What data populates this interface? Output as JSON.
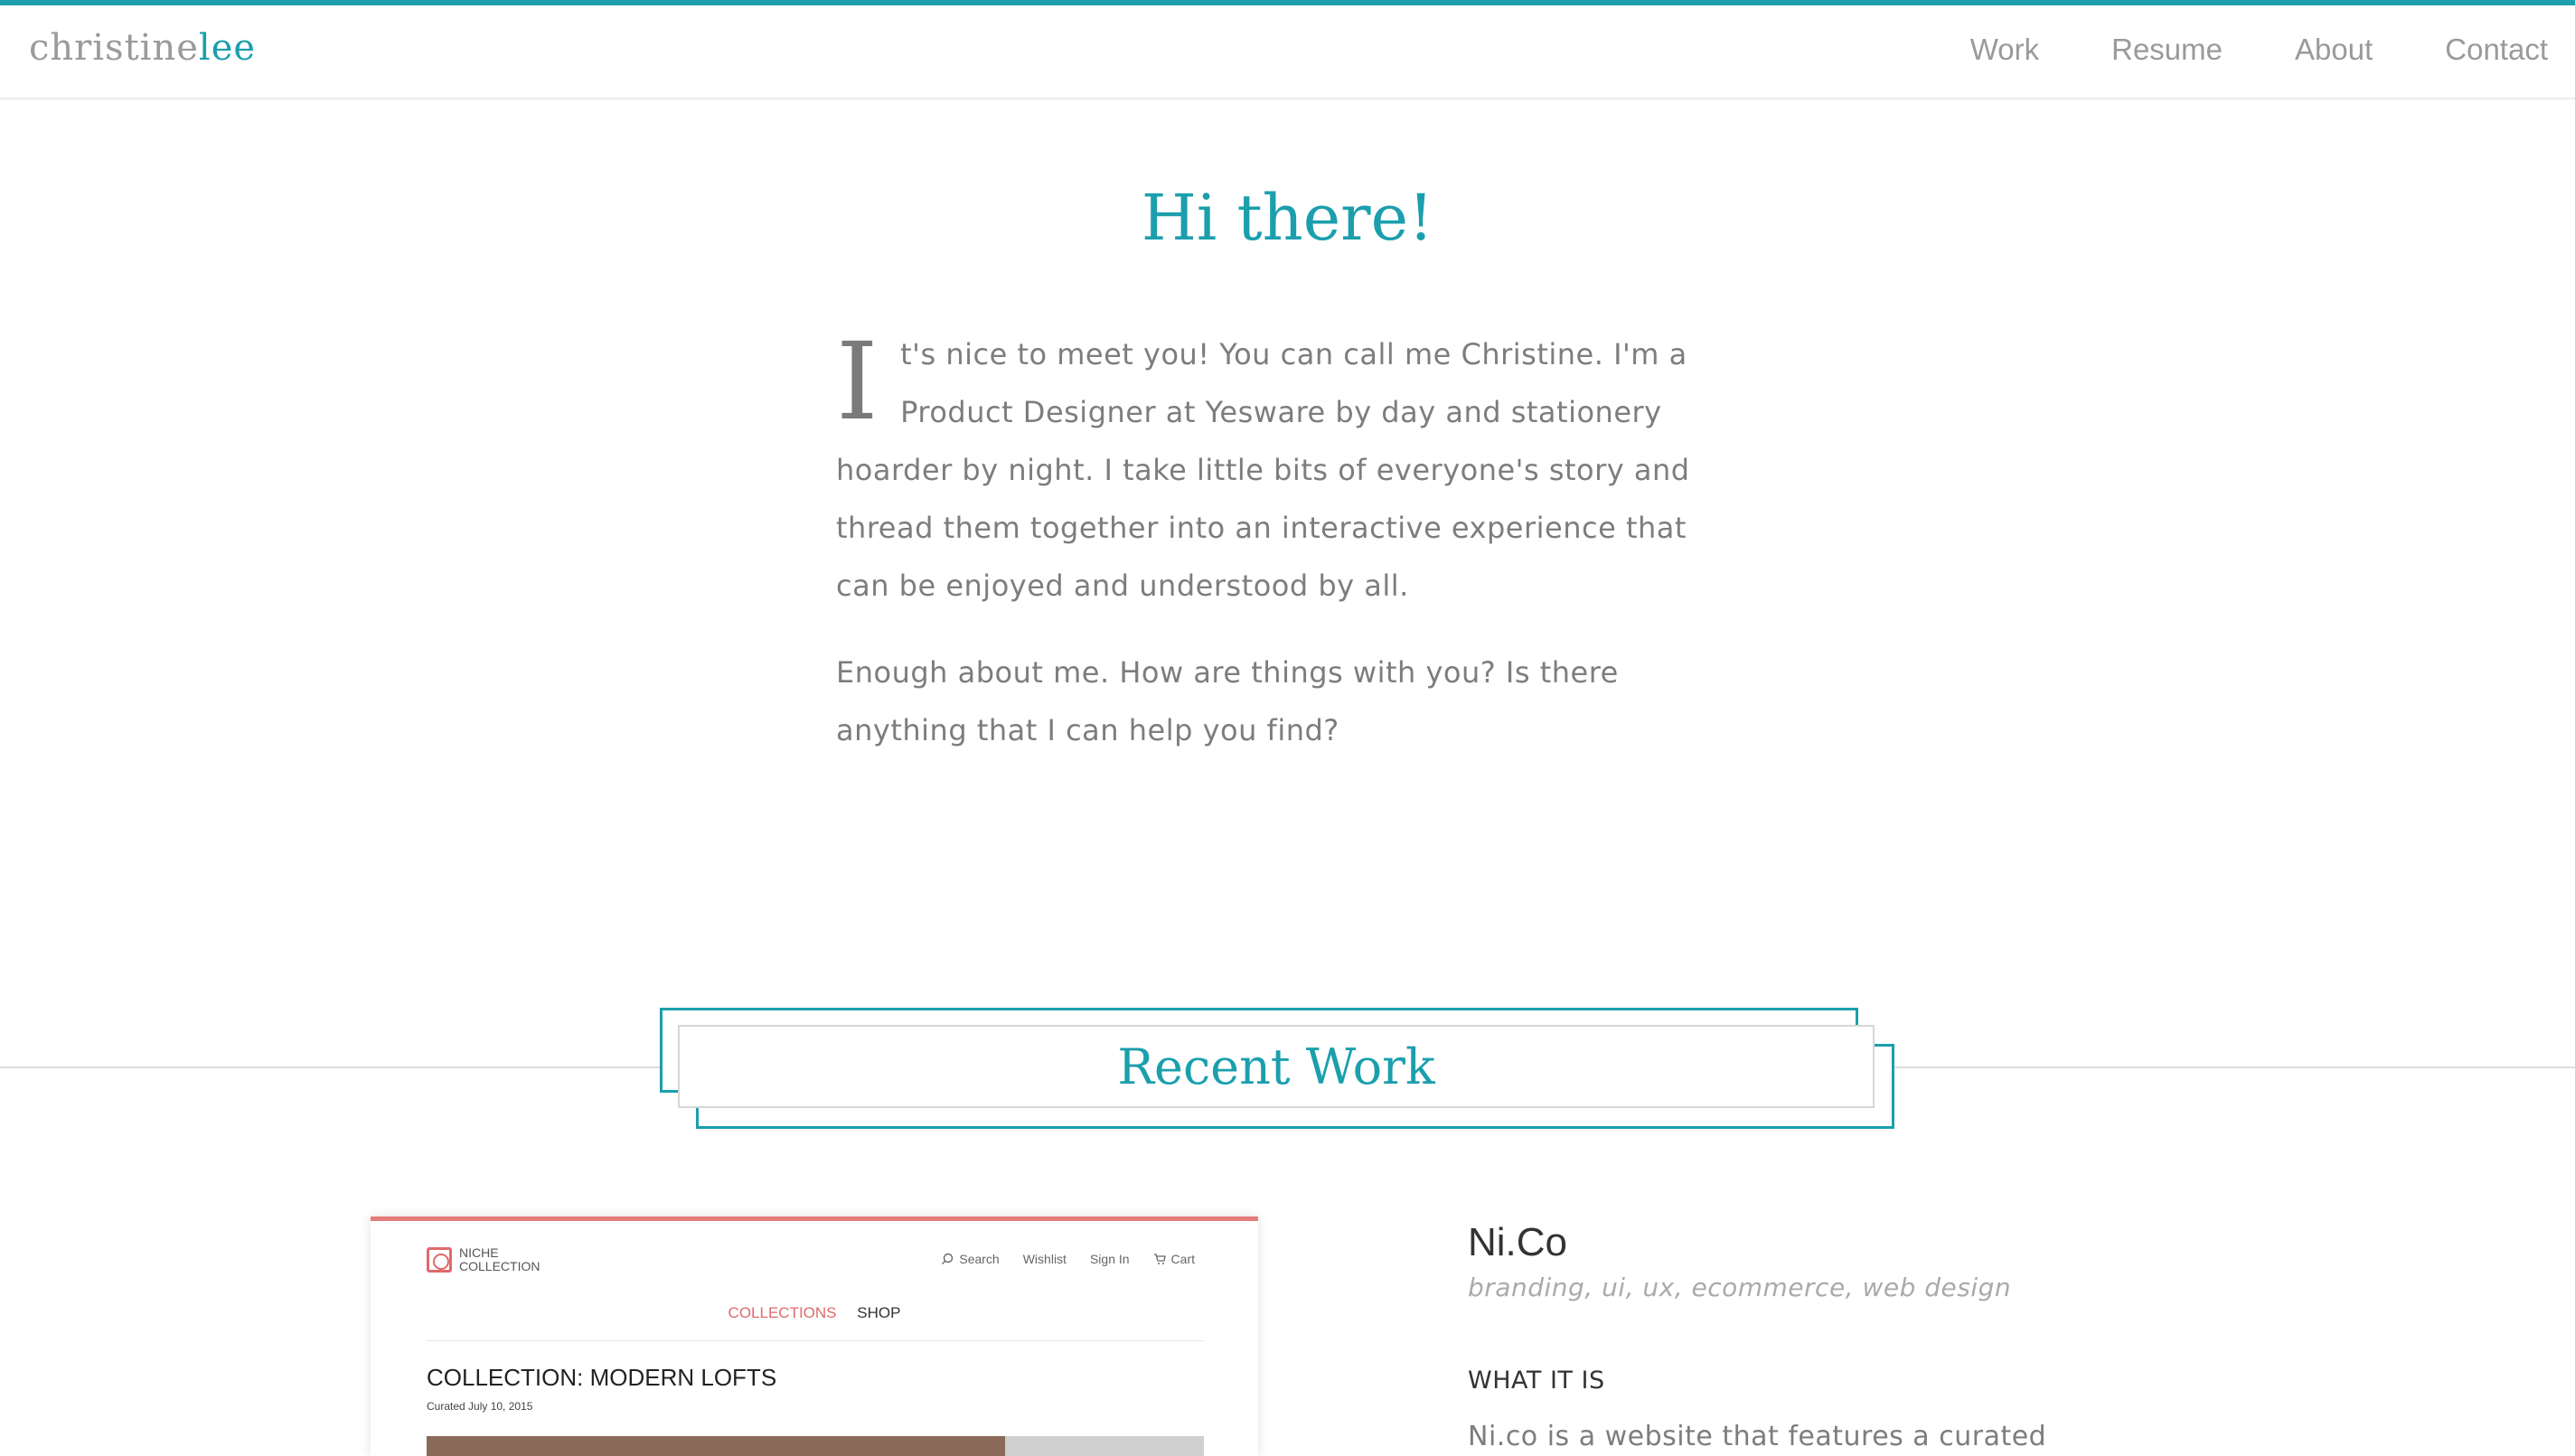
{
  "colors": {
    "accent": "#1b9fad",
    "text": "#7a7a7a",
    "preview_accent": "#e06a6a"
  },
  "header": {
    "logo_first": "christine",
    "logo_last": "lee",
    "nav": [
      "Work",
      "Resume",
      "About",
      "Contact"
    ]
  },
  "hero": {
    "title": "Hi there!",
    "dropcap": "I",
    "paragraph1_rest": "t's nice to meet you! You can call me Christine. I'm a Product Designer at Yesware by day and stationery hoarder by night. I take little bits of everyone's story and thread them together into an interactive experience that can be enjoyed and understood by all.",
    "paragraph2": "Enough about me. How are things with you? Is there anything that I can help you find?"
  },
  "recent_work": {
    "heading": "Recent Work"
  },
  "project": {
    "preview": {
      "logo_line1": "NICHE",
      "logo_line2": "COLLECTION",
      "nav": [
        "Search",
        "Wishlist",
        "Sign In",
        "Cart"
      ],
      "tab_collections": "COLLECTIONS",
      "tab_shop": "SHOP",
      "title": "COLLECTION: MODERN LOFTS",
      "date": "Curated July 10, 2015"
    },
    "name": "Ni.Co",
    "tags": "branding, ui, ux, ecommerce, web design",
    "section_label": "WHAT IT IS",
    "description": "Ni.co is a website that features a curated"
  }
}
